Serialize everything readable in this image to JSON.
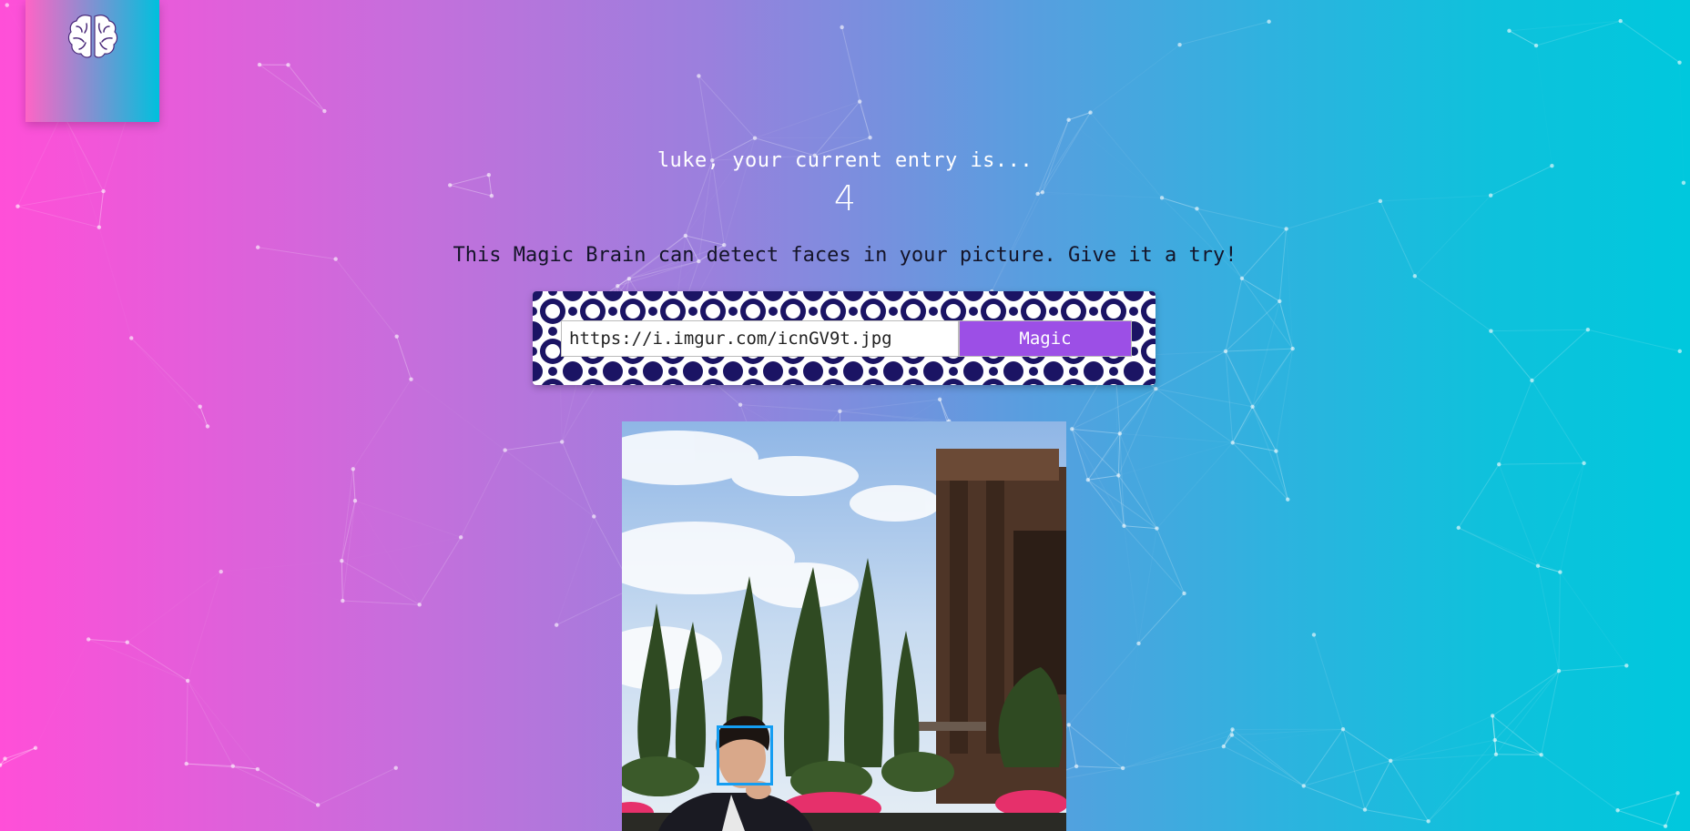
{
  "header": {
    "logo": {
      "icon": "brain-icon"
    }
  },
  "entry": {
    "message": "luke, your current entry is...",
    "count": "4"
  },
  "tagline": "This Magic Brain can detect faces in your picture. Give it a try!",
  "form": {
    "url_value": "https://i.imgur.com/icnGV9t.jpg",
    "submit_label": "Magic"
  },
  "colors": {
    "gradient_left": "#ff4fd8",
    "gradient_right": "#00c8dd",
    "button": "#9c4fe6",
    "face_box": "#149df2",
    "pattern": "#1b1464"
  }
}
